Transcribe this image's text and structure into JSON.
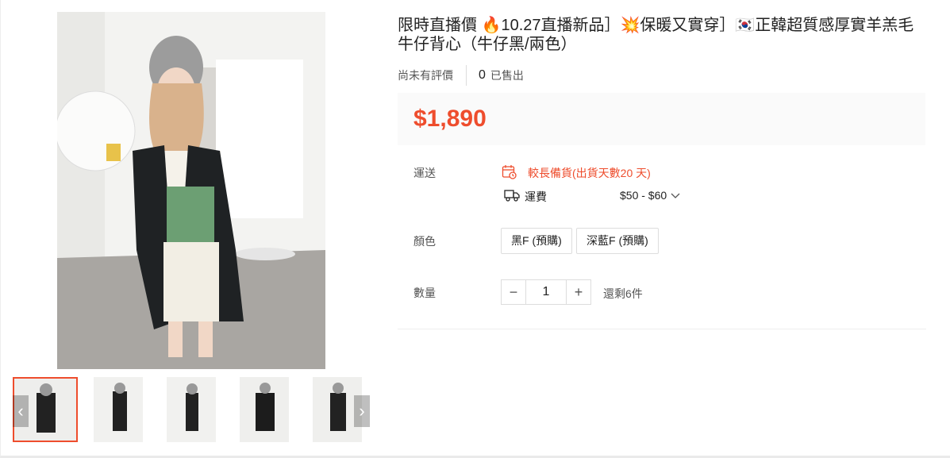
{
  "product": {
    "title": "限時直播價 🔥10.27直播新品］💥保暖又實穿］🇰🇷正韓超質感厚實羊羔毛牛仔背心（牛仔黑/兩色）",
    "rating_text": "尚未有評價",
    "sold_count": "0",
    "sold_label": "已售出",
    "price": "$1,890"
  },
  "shipping": {
    "label": "運送",
    "warning": "較長備貨(出貨天數20 天)",
    "fee_label": "運費",
    "fee_value": "$50 - $60"
  },
  "color": {
    "label": "顏色",
    "options": [
      "黑F (預購)",
      "深藍F (預購)"
    ]
  },
  "quantity": {
    "label": "數量",
    "value": "1",
    "stock": "還剩6件",
    "minus": "−",
    "plus": "+"
  },
  "gallery": {
    "prev": "‹",
    "next": "›"
  },
  "colors": {
    "accent": "#ee4d2d",
    "price_bg": "#fafafa"
  }
}
